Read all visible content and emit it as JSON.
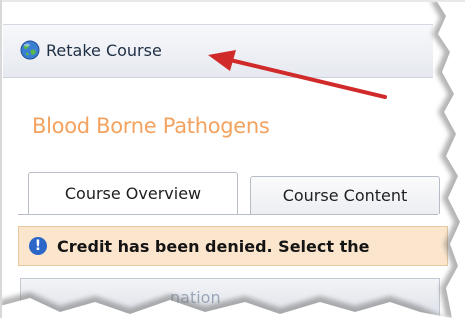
{
  "toolbar": {
    "retake_label": "Retake Course",
    "retake_icon": "globe-icon"
  },
  "course": {
    "title": "Blood Borne Pathogens"
  },
  "tabs": [
    {
      "label": "Course Overview",
      "active": true
    },
    {
      "label": "Course Content",
      "active": false
    }
  ],
  "alert": {
    "icon": "info-icon",
    "text": "Credit has been denied. Select the"
  },
  "lower_panel": {
    "text": "nation"
  },
  "colors": {
    "title_orange": "#f3a25f",
    "alert_bg": "#fbe6cd",
    "arrow_red": "#d12a2a",
    "info_blue": "#2c67c8"
  }
}
